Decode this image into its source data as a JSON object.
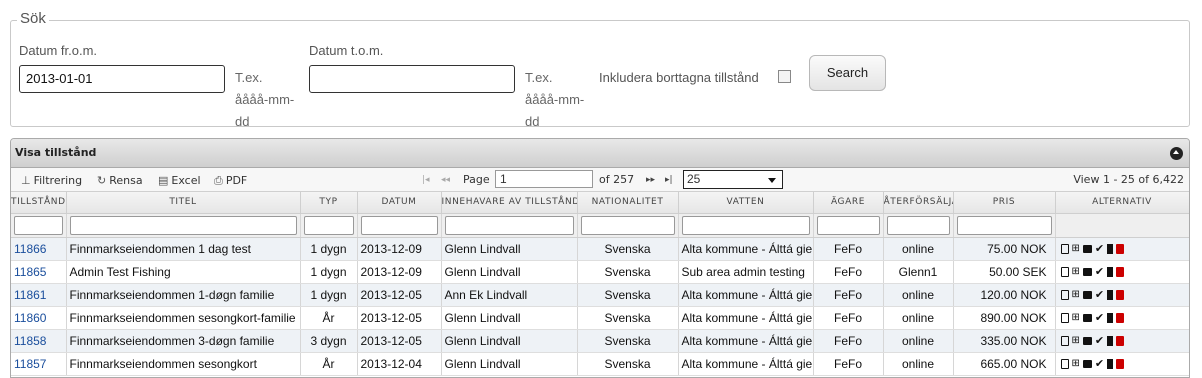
{
  "search": {
    "legend": "Sök",
    "from_label": "Datum fr.o.m.",
    "from_value": "2013-01-01",
    "to_label": "Datum t.o.m.",
    "to_value": "",
    "hint_from": "T.ex. åååå-mm-dd",
    "hint_to": "T.ex. åååå-mm-dd",
    "include_deleted_label": "Inkludera borttagna tillstånd",
    "include_deleted_checked": false,
    "search_button": "Search"
  },
  "grid": {
    "caption": "Visa tillstånd",
    "toolbar": {
      "filter": "Filtrering",
      "clear": "Rensa",
      "excel": "Excel",
      "pdf": "PDF",
      "page_label": "Page",
      "page_value": "1",
      "of_pages": "of 257",
      "rows_per_page": "25",
      "view_info": "View 1 - 25 of 6,422"
    },
    "columns": [
      "TILLSTÅNDSNR",
      "TITEL",
      "TYP",
      "DATUM",
      "INNEHAVARE AV TILLSTÅND",
      "NATIONALITET",
      "VATTEN",
      "ÄGARE",
      "ÅTERFÖRSÄLJARE",
      "PRIS",
      "ALTERNATIV"
    ],
    "rows": [
      {
        "id": "11866",
        "title": "Finnmarkseiendommen 1 dag test",
        "type": "1 dygn",
        "date": "2013-12-09",
        "holder": "Glenn Lindvall",
        "nationality": "Svenska",
        "water": "Alta kommune - Álttá gielda",
        "owner": "FeFo",
        "reseller": "online",
        "price": "75.00 NOK"
      },
      {
        "id": "11865",
        "title": "Admin Test Fishing",
        "type": "1 dygn",
        "date": "2013-12-09",
        "holder": "Glenn Lindvall",
        "nationality": "Svenska",
        "water": "Sub area admin testing",
        "owner": "FeFo",
        "reseller": "Glenn1",
        "price": "50.00 SEK"
      },
      {
        "id": "11861",
        "title": "Finnmarkseiendommen 1-døgn familie",
        "type": "1 dygn",
        "date": "2013-12-05",
        "holder": "Ann Ek Lindvall",
        "nationality": "Svenska",
        "water": "Alta kommune - Álttá gielda",
        "owner": "FeFo",
        "reseller": "online",
        "price": "120.00 NOK"
      },
      {
        "id": "11860",
        "title": "Finnmarkseiendommen sesongkort-familie",
        "type": "År",
        "date": "2013-12-05",
        "holder": "Glenn Lindvall",
        "nationality": "Svenska",
        "water": "Alta kommune - Álttá gielda",
        "owner": "FeFo",
        "reseller": "online",
        "price": "890.00 NOK"
      },
      {
        "id": "11858",
        "title": "Finnmarkseiendommen 3-døgn familie",
        "type": "3 dygn",
        "date": "2013-12-05",
        "holder": "Glenn Lindvall",
        "nationality": "Svenska",
        "water": "Alta kommune - Álttá gielda",
        "owner": "FeFo",
        "reseller": "online",
        "price": "335.00 NOK"
      },
      {
        "id": "11857",
        "title": "Finnmarkseiendommen sesongkort",
        "type": "År",
        "date": "2013-12-04",
        "holder": "Glenn Lindvall",
        "nationality": "Svenska",
        "water": "Alta kommune - Álttá gielda",
        "owner": "FeFo",
        "reseller": "online",
        "price": "665.00 NOK"
      }
    ],
    "row_actions": [
      "document-icon",
      "cart-icon",
      "print-icon",
      "check-icon",
      "film-icon",
      "trash-icon"
    ]
  }
}
